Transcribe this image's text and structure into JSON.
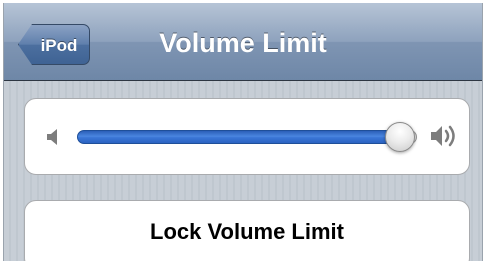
{
  "navbar": {
    "back_label": "iPod",
    "title": "Volume Limit"
  },
  "volume_slider": {
    "value": 0.95,
    "min_icon": "speaker-low-icon",
    "max_icon": "speaker-high-icon"
  },
  "lock_button": {
    "label": "Lock Volume Limit"
  },
  "colors": {
    "navbar": "#6e87a7",
    "slider_fill": "#3b76d6",
    "background": "#c5ccd4"
  }
}
